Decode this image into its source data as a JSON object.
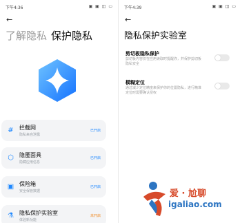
{
  "left": {
    "status_time": "下午4:36",
    "status_icons": "▣ ▣ ◫ ▭",
    "title_light": "了解隐私",
    "title_dark": "保护隐私",
    "cards": [
      {
        "icon": "hash-icon",
        "glyph": "#",
        "title": "拦截网",
        "sub": "隐私来自泄露",
        "status": "已开启"
      },
      {
        "icon": "cube-icon",
        "glyph": "⬡",
        "title": "隐匿面具",
        "sub": "隐藏应用信息",
        "status": "已开启"
      },
      {
        "icon": "safe-icon",
        "glyph": "▣",
        "title": "保险箱",
        "sub": "安全保管数据",
        "status": "已开启"
      },
      {
        "icon": "lab-icon",
        "glyph": "⚗",
        "title": "隐私保护实验室",
        "sub": "体验新功能",
        "status": "未开启"
      }
    ]
  },
  "right": {
    "status_time": "下午4:39",
    "status_icons": "▣ ▣ ◫ ▭",
    "title": "隐私保护实验室",
    "options": [
      {
        "title": "剪切板隐私保护",
        "desc": "剪切板内容仅在应用读取时提醒你，并保护剪切板隐私安全"
      },
      {
        "title": "模糊定位",
        "desc": "通过减少定位精度来保护你的位置隐私，进行精准定位时需要确认授权"
      }
    ]
  },
  "watermark": {
    "text": "爱 · 尬聊",
    "url": "igaliao.com"
  },
  "colors": {
    "accent": "#1e88ff",
    "orange": "#f08a24",
    "card_bg": "#f3f4f6"
  }
}
